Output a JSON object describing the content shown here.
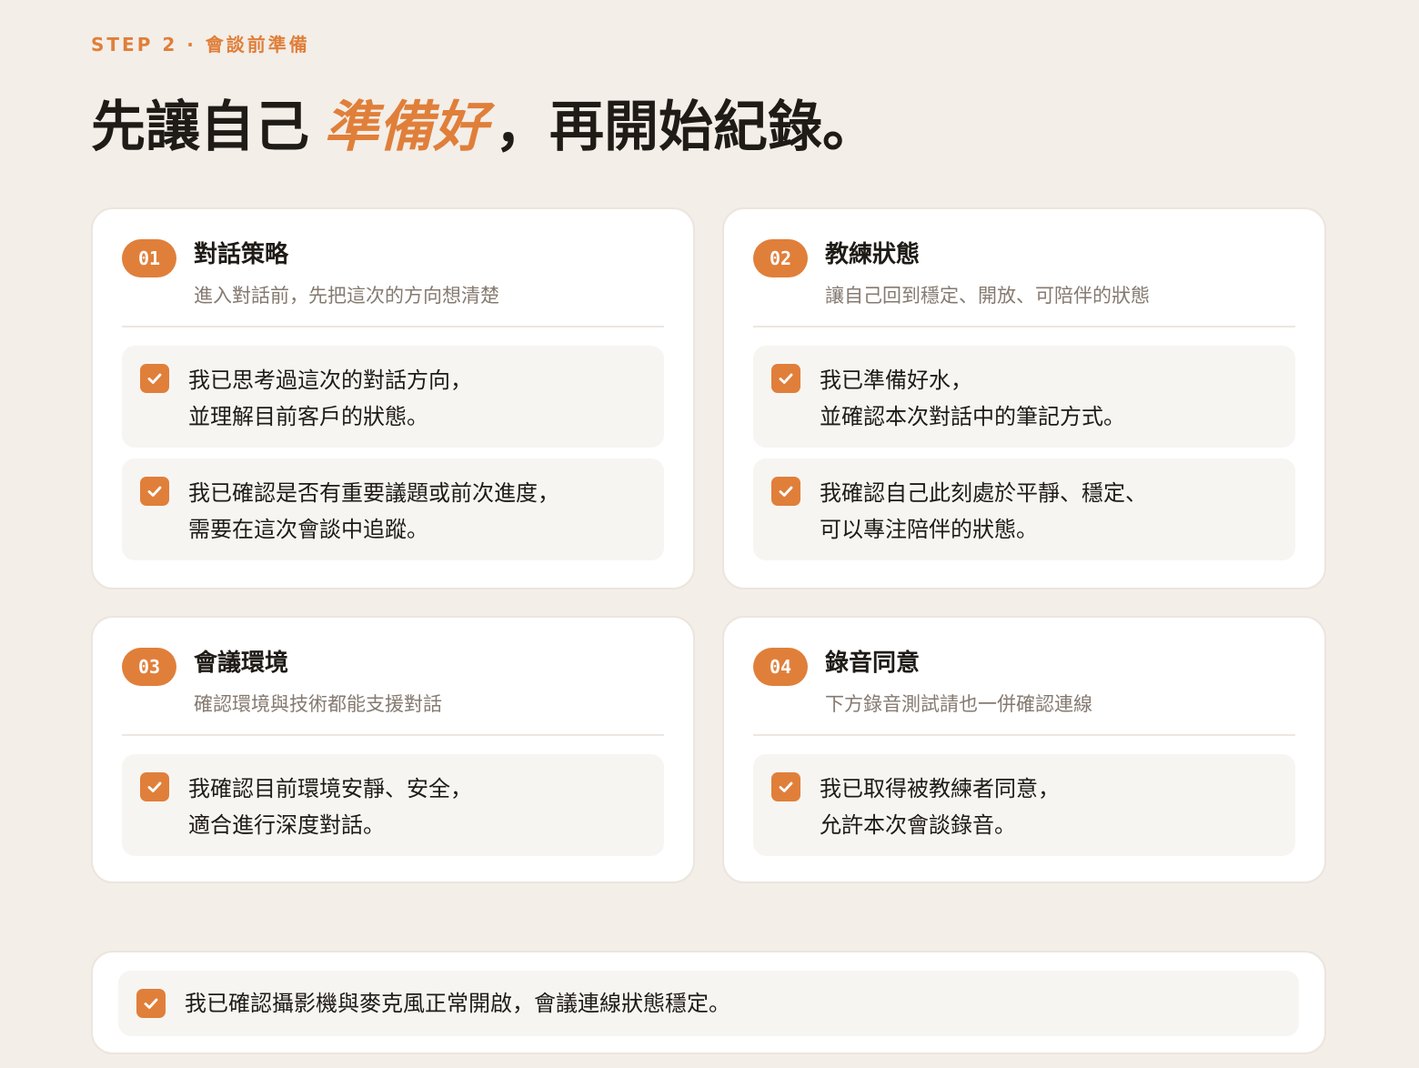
{
  "step_label": "STEP 2 · 會談前準備",
  "headline": {
    "before": "先讓自己",
    "accent": "準備好",
    "after": "，再開始紀錄。"
  },
  "accent_color": "#e07f3a",
  "sections": [
    {
      "number": "01",
      "title": "對話策略",
      "subtitle": "進入對話前，先把這次的方向想清楚",
      "items": [
        "我已思考過這次的對話方向，\n並理解目前客戶的狀態。",
        "我已確認是否有重要議題或前次進度，\n需要在這次會談中追蹤。"
      ]
    },
    {
      "number": "02",
      "title": "教練狀態",
      "subtitle": "讓自己回到穩定、開放、可陪伴的狀態",
      "items": [
        "我已準備好水，\n並確認本次對話中的筆記方式。",
        "我確認自己此刻處於平靜、穩定、\n可以專注陪伴的狀態。"
      ]
    },
    {
      "number": "03",
      "title": "會議環境",
      "subtitle": "確認環境與技術都能支援對話",
      "items": [
        "我確認目前環境安靜、安全，\n適合進行深度對話。"
      ]
    },
    {
      "number": "04",
      "title": "錄音同意",
      "subtitle": "下方錄音測試請也一併確認連線",
      "items": [
        "我已取得被教練者同意，\n允許本次會談錄音。"
      ]
    }
  ],
  "final_check": "我已確認攝影機與麥克風正常開啟，會議連線狀態穩定。"
}
